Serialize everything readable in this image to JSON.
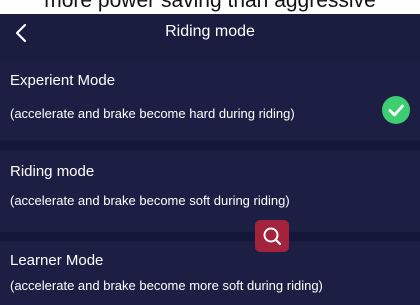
{
  "top_text": "more power saving than aggressive",
  "header": {
    "title": "Riding mode"
  },
  "modes": [
    {
      "name": "Experient Mode",
      "description": "(accelerate and brake become hard during riding)",
      "selected": true
    },
    {
      "name": "Riding mode",
      "description": "(accelerate and brake become soft during riding)",
      "selected": false
    },
    {
      "name": "Learner Mode",
      "description": "(accelerate and brake become more soft during riding)",
      "selected": false
    }
  ],
  "icons": {
    "back": "chevron-left-icon",
    "selected": "check-circle-icon",
    "zoom": "magnifier-icon"
  },
  "colors": {
    "background": "#1b1d40",
    "check": "#3dcd72",
    "zoom_button": "#a3223c"
  }
}
